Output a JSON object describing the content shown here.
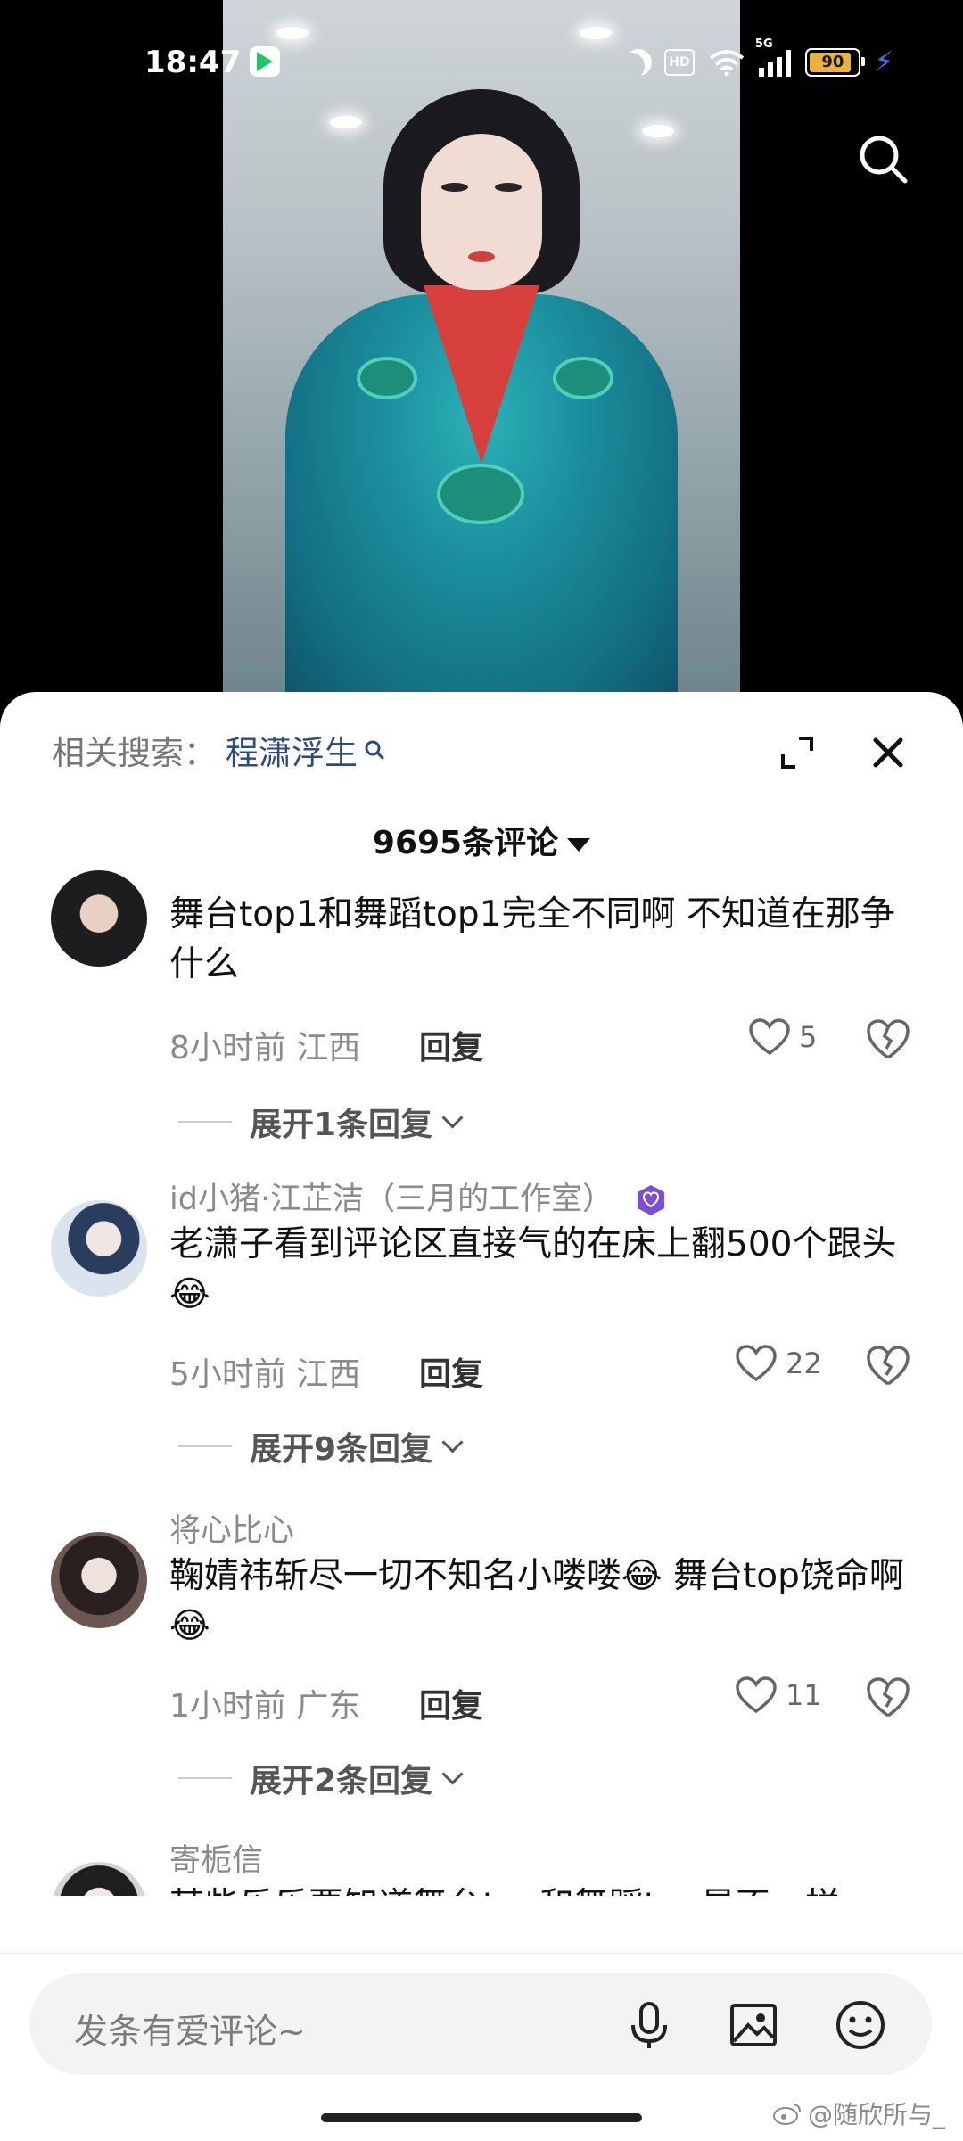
{
  "status_bar": {
    "time": "18:47",
    "hd_label": "HD",
    "network_label": "5G",
    "battery_level": "90",
    "battery_percent": 90,
    "charging": true
  },
  "video": {
    "search_icon": "search-icon"
  },
  "sheet": {
    "related_search_label": "相关搜索：",
    "related_search_term": "程潇浮生",
    "comment_count_label": "9695条评论"
  },
  "comments": [
    {
      "username": "",
      "text": "舞台top1和舞蹈top1完全不同啊 不知道在那争什么",
      "time_location": "8小时前 江西",
      "reply_label": "回复",
      "likes": "5",
      "expand_label": "展开1条回复"
    },
    {
      "username": "id小猪·江芷洁（三月的工作室）",
      "text": "老潇子看到评论区直接气的在床上翻500个跟头😂",
      "time_location": "5小时前 江西",
      "reply_label": "回复",
      "likes": "22",
      "expand_label": "展开9条回复"
    },
    {
      "username": "将心比心",
      "text": "鞠婧祎斩尽一切不知名小喽喽😂 舞台top饶命啊😂",
      "time_location": "1小时前 广东",
      "reply_label": "回复",
      "likes": "11",
      "expand_label": "展开2条回复"
    },
    {
      "username": "寄栀信",
      "text": "某些乐乐要知道舞台top和舞蹈top是不一样"
    }
  ],
  "input_bar": {
    "placeholder": "发条有爱评论~"
  },
  "watermark": "@随欣所与_",
  "colors": {
    "link_blue": "#2d4a83",
    "verified_purple": "#7b4fd1",
    "charging_bolt": "#2d7cff"
  }
}
